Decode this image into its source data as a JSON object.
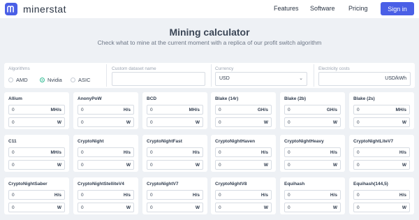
{
  "nav": {
    "brand": "minerstat",
    "links": [
      "Features",
      "Software",
      "Pricing"
    ],
    "signin": "Sign in",
    "accent": "#4a5fe6"
  },
  "hero": {
    "title": "Mining calculator",
    "subtitle": "Check what to mine at the current moment with a replica of our profit switch algorithm"
  },
  "settings": {
    "algorithms_label": "Algorithms",
    "options": [
      "AMD",
      "Nvidia",
      "ASIC"
    ],
    "selected": "Nvidia",
    "dataset_label": "Custom dataset name",
    "dataset_value": "",
    "currency_label": "Currency",
    "currency_value": "USD",
    "electricity_label": "Electricity costs",
    "electricity_unit": "USD/kWh",
    "selected_color": "#3dbf9a"
  },
  "cards": [
    {
      "title": "Allium",
      "hashrate": "0",
      "unit": "MH/s",
      "power": "0",
      "power_unit": "W"
    },
    {
      "title": "AnonyPoW",
      "hashrate": "0",
      "unit": "H/s",
      "power": "0",
      "power_unit": "W"
    },
    {
      "title": "BCD",
      "hashrate": "0",
      "unit": "MH/s",
      "power": "0",
      "power_unit": "W"
    },
    {
      "title": "Blake (14r)",
      "hashrate": "0",
      "unit": "GH/s",
      "power": "0",
      "power_unit": "W"
    },
    {
      "title": "Blake (2b)",
      "hashrate": "0",
      "unit": "GH/s",
      "power": "0",
      "power_unit": "W"
    },
    {
      "title": "Blake (2s)",
      "hashrate": "0",
      "unit": "MH/s",
      "power": "0",
      "power_unit": "W"
    },
    {
      "title": "C11",
      "hashrate": "0",
      "unit": "MH/s",
      "power": "0",
      "power_unit": "W"
    },
    {
      "title": "CryptoNight",
      "hashrate": "0",
      "unit": "H/s",
      "power": "0",
      "power_unit": "W"
    },
    {
      "title": "CryptoNightFast",
      "hashrate": "0",
      "unit": "H/s",
      "power": "0",
      "power_unit": "W"
    },
    {
      "title": "CryptoNightHaven",
      "hashrate": "0",
      "unit": "H/s",
      "power": "0",
      "power_unit": "W"
    },
    {
      "title": "CryptoNightHeavy",
      "hashrate": "0",
      "unit": "H/s",
      "power": "0",
      "power_unit": "W"
    },
    {
      "title": "CryptoNightLiteV7",
      "hashrate": "0",
      "unit": "H/s",
      "power": "0",
      "power_unit": "W"
    },
    {
      "title": "CryptoNightSaber",
      "hashrate": "0",
      "unit": "H/s",
      "power": "0",
      "power_unit": "W"
    },
    {
      "title": "CryptoNightStelliteV4",
      "hashrate": "0",
      "unit": "H/s",
      "power": "0",
      "power_unit": "W"
    },
    {
      "title": "CryptoNightV7",
      "hashrate": "0",
      "unit": "H/s",
      "power": "0",
      "power_unit": "W"
    },
    {
      "title": "CryptoNightV8",
      "hashrate": "0",
      "unit": "H/s",
      "power": "0",
      "power_unit": "W"
    },
    {
      "title": "Equihash",
      "hashrate": "0",
      "unit": "H/s",
      "power": "0",
      "power_unit": "W"
    },
    {
      "title": "Equihash(144,5)",
      "hashrate": "0",
      "unit": "H/s",
      "power": "0",
      "power_unit": "W"
    }
  ]
}
